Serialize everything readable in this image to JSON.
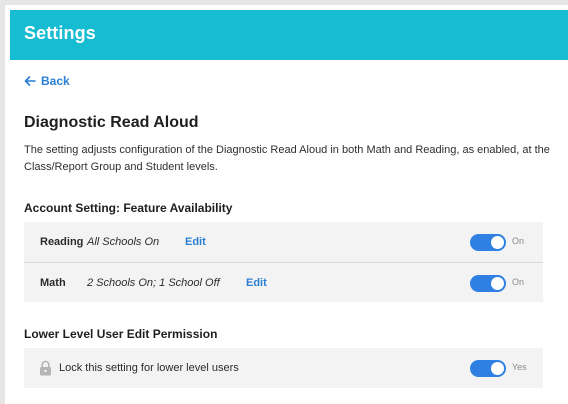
{
  "header": {
    "title": "Settings"
  },
  "nav": {
    "back_label": "Back",
    "back_icon": "arrow-left-icon"
  },
  "page": {
    "title": "Diagnostic Read Aloud",
    "description": "The setting adjusts configuration of the Diagnostic Read Aloud in both Math and Reading, as enabled, at the Class/Report Group and Student levels."
  },
  "account_setting": {
    "title": "Account Setting: Feature Availability",
    "rows": [
      {
        "label": "Reading",
        "value": "All Schools On",
        "edit_label": "Edit",
        "toggle_on": true,
        "toggle_text": "On"
      },
      {
        "label": "Math",
        "value": "2 Schools On; 1 School Off",
        "edit_label": "Edit",
        "toggle_on": true,
        "toggle_text": "On"
      }
    ]
  },
  "permission": {
    "title": "Lower Level User Edit Permission",
    "lock_icon": "lock-icon",
    "lock_label": "Lock this setting for lower level users",
    "toggle_on": true,
    "toggle_text": "Yes"
  },
  "colors": {
    "header_bg": "#16bcd2",
    "link": "#2a7fd4",
    "toggle_on": "#2f80e2",
    "row_bg": "#f3f3f3"
  }
}
